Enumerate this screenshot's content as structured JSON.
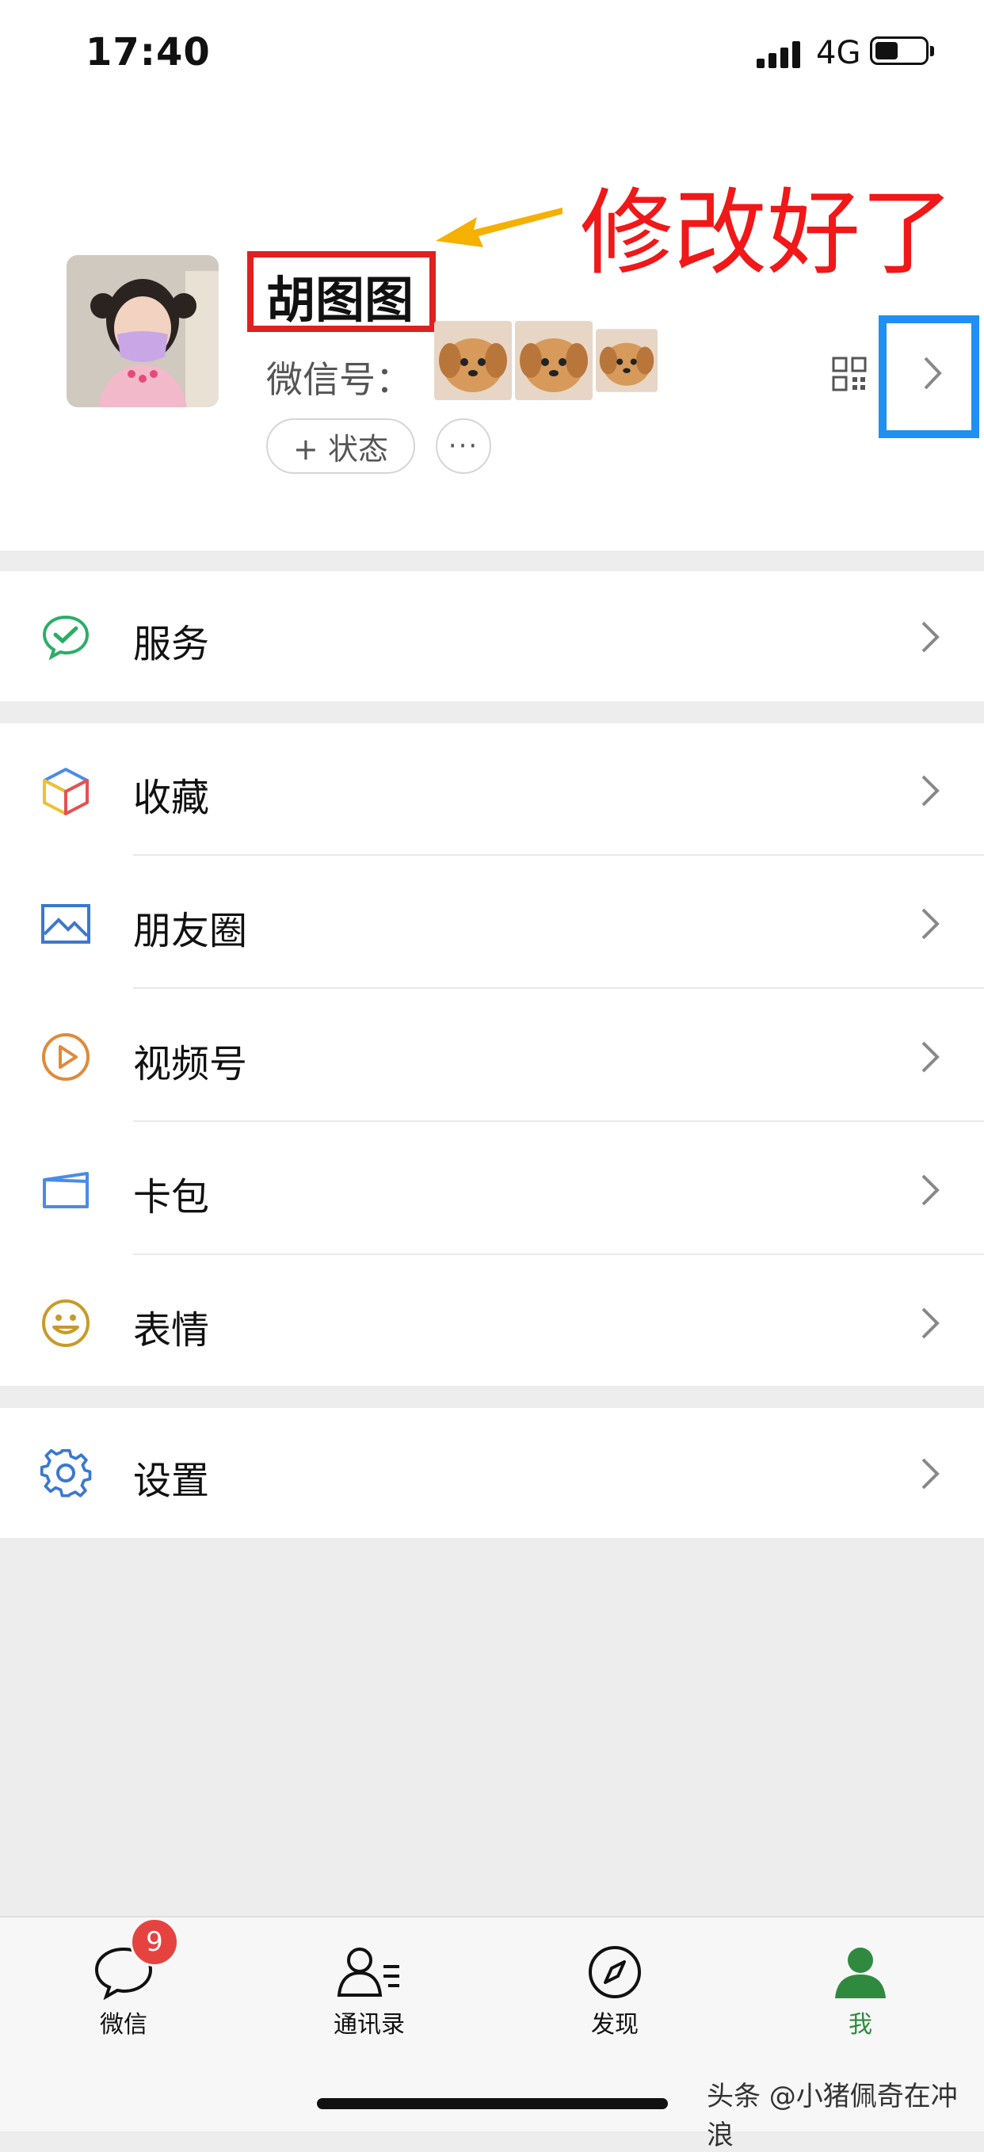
{
  "status_bar": {
    "time": "17:40",
    "network": "4G"
  },
  "profile": {
    "name": "胡图图",
    "wechat_id_label": "微信号：",
    "status_button": "+ 状态",
    "more_button": "···"
  },
  "annotation": {
    "text": "修改好了",
    "color": "#f01818",
    "box_color": "#1f8ff0"
  },
  "groups": {
    "services": [
      {
        "label": "服务",
        "icon": "wechat-pay-icon"
      }
    ],
    "main": [
      {
        "label": "收藏",
        "icon": "favorites-cube-icon"
      },
      {
        "label": "朋友圈",
        "icon": "moments-image-icon"
      },
      {
        "label": "视频号",
        "icon": "channels-play-icon"
      },
      {
        "label": "卡包",
        "icon": "card-wallet-icon"
      },
      {
        "label": "表情",
        "icon": "smiley-icon"
      }
    ],
    "settings": [
      {
        "label": "设置",
        "icon": "gear-icon"
      }
    ]
  },
  "tabbar": {
    "tabs": [
      {
        "label": "微信",
        "icon": "chat-bubble-icon"
      },
      {
        "label": "通讯录",
        "icon": "contacts-icon"
      },
      {
        "label": "发现",
        "icon": "compass-icon"
      },
      {
        "label": "我",
        "icon": "person-icon",
        "active": true
      }
    ],
    "badge_count": "9",
    "active_color": "#2f8a3f"
  },
  "watermark": "头条 @小猪佩奇在冲浪"
}
